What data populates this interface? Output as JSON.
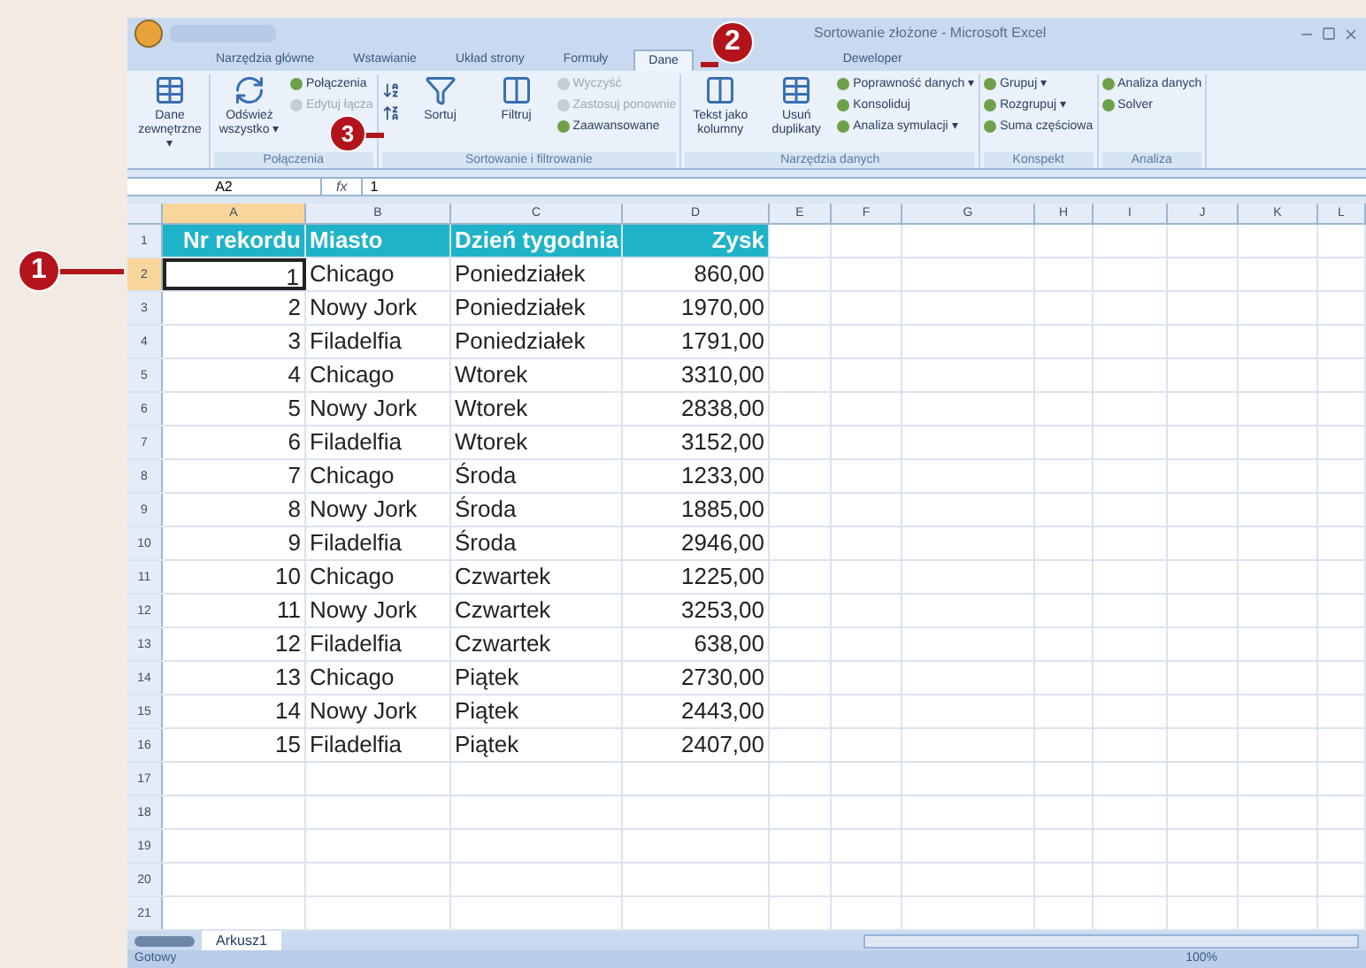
{
  "window": {
    "title": "Sortowanie złożone - Microsoft Excel"
  },
  "tabs": [
    {
      "label": "Narzędzia główne",
      "selected": false
    },
    {
      "label": "Wstawianie",
      "selected": false
    },
    {
      "label": "Układ strony",
      "selected": false
    },
    {
      "label": "Formuły",
      "selected": false
    },
    {
      "label": "Dane",
      "selected": true
    },
    {
      "label": "Deweloper",
      "selected": false
    }
  ],
  "ribbon_groups": [
    {
      "kind": "plain",
      "items": [
        {
          "kind": "large",
          "label": "Dane zewnętrzne ▾",
          "disabled": false
        }
      ]
    },
    {
      "kind": "plain",
      "label": "Połączenia",
      "items": [
        {
          "kind": "large",
          "label": "Odśwież wszystko ▾",
          "disabled": false
        },
        {
          "kind": "small",
          "label": "Połączenia",
          "disabled": false
        },
        {
          "kind": "small",
          "label": "Edytuj łącza",
          "disabled": true
        }
      ]
    },
    {
      "kind": "sort",
      "label": "Sortowanie i filtrowanie",
      "items": [
        {
          "kind": "large",
          "label": "Sortuj",
          "disabled": false
        },
        {
          "kind": "large",
          "label": "Filtruj",
          "disabled": false
        },
        {
          "kind": "small",
          "label": "Wyczyść",
          "disabled": true
        },
        {
          "kind": "small",
          "label": "Zastosuj ponownie",
          "disabled": true
        },
        {
          "kind": "small",
          "label": "Zaawansowane",
          "disabled": false
        }
      ]
    },
    {
      "kind": "plain",
      "label": "Narzędzia danych",
      "items": [
        {
          "kind": "large",
          "label": "Tekst jako kolumny",
          "disabled": false
        },
        {
          "kind": "large",
          "label": "Usuń duplikaty",
          "disabled": false
        },
        {
          "kind": "small",
          "label": "Poprawność danych ▾",
          "disabled": false
        },
        {
          "kind": "small",
          "label": "Konsoliduj",
          "disabled": false
        },
        {
          "kind": "small",
          "label": "Analiza symulacji ▾",
          "disabled": false
        }
      ]
    },
    {
      "kind": "plain",
      "label": "Konspekt",
      "items": [
        {
          "kind": "small",
          "label": "Grupuj ▾",
          "disabled": false
        },
        {
          "kind": "small",
          "label": "Rozgrupuj ▾",
          "disabled": false
        },
        {
          "kind": "small",
          "label": "Suma częściowa",
          "disabled": false
        }
      ]
    },
    {
      "kind": "plain",
      "label": "Analiza",
      "items": [
        {
          "kind": "small",
          "label": "Analiza danych",
          "disabled": false
        },
        {
          "kind": "small",
          "label": "Solver",
          "disabled": false
        }
      ]
    }
  ],
  "formula_bar": {
    "name_box": "A2",
    "fx": "fx",
    "value": "1"
  },
  "columns": [
    "A",
    "B",
    "C",
    "D",
    "E",
    "F",
    "G",
    "H",
    "I",
    "J",
    "K",
    "L"
  ],
  "header_row": [
    "Nr rekordu",
    "Miasto",
    "Dzień tygodnia",
    "Zysk"
  ],
  "rows": [
    [
      "1",
      "Chicago",
      "Poniedziałek",
      "860,00"
    ],
    [
      "2",
      "Nowy Jork",
      "Poniedziałek",
      "1970,00"
    ],
    [
      "3",
      "Filadelfia",
      "Poniedziałek",
      "1791,00"
    ],
    [
      "4",
      "Chicago",
      "Wtorek",
      "3310,00"
    ],
    [
      "5",
      "Nowy Jork",
      "Wtorek",
      "2838,00"
    ],
    [
      "6",
      "Filadelfia",
      "Wtorek",
      "3152,00"
    ],
    [
      "7",
      "Chicago",
      "Środa",
      "1233,00"
    ],
    [
      "8",
      "Nowy Jork",
      "Środa",
      "1885,00"
    ],
    [
      "9",
      "Filadelfia",
      "Środa",
      "2946,00"
    ],
    [
      "10",
      "Chicago",
      "Czwartek",
      "1225,00"
    ],
    [
      "11",
      "Nowy Jork",
      "Czwartek",
      "3253,00"
    ],
    [
      "12",
      "Filadelfia",
      "Czwartek",
      "638,00"
    ],
    [
      "13",
      "Chicago",
      "Piątek",
      "2730,00"
    ],
    [
      "14",
      "Nowy Jork",
      "Piątek",
      "2443,00"
    ],
    [
      "15",
      "Filadelfia",
      "Piątek",
      "2407,00"
    ]
  ],
  "row_numbers": [
    "1",
    "2",
    "3",
    "4",
    "5",
    "6",
    "7",
    "8",
    "9",
    "10",
    "11",
    "12",
    "13",
    "14",
    "15",
    "16",
    "17",
    "18",
    "19",
    "20",
    "21"
  ],
  "sheet_tabs": [
    {
      "label": "Arkusz1",
      "selected": true
    }
  ],
  "status_bar": {
    "status": "Gotowy",
    "zoom": "100%"
  },
  "callouts": [
    "1",
    "2",
    "3"
  ]
}
